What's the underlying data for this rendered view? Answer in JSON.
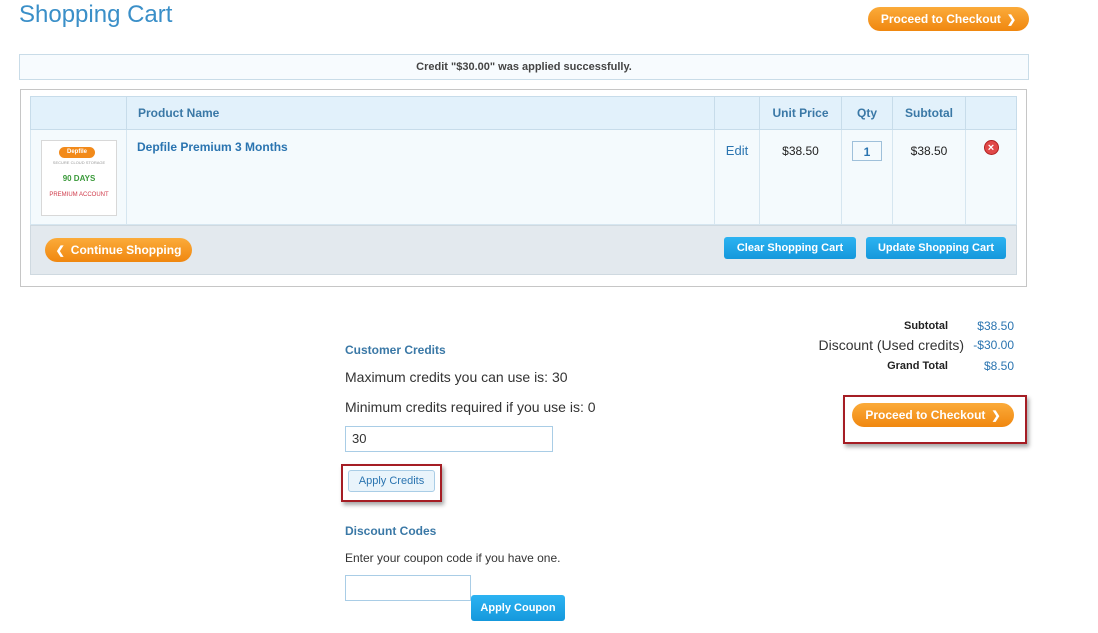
{
  "page": {
    "title": "Shopping Cart"
  },
  "top_checkout": {
    "label": "Proceed to Checkout"
  },
  "message": "Credit \"$30.00\" was applied successfully.",
  "cart": {
    "headers": {
      "product_name": "Product Name",
      "unit_price": "Unit Price",
      "qty": "Qty",
      "subtotal": "Subtotal"
    },
    "items": [
      {
        "thumb": {
          "logo": "Depfile",
          "tagline": "SECURE CLOUD STORAGE",
          "days": "90 DAYS",
          "premium": "PREMIUM ACCOUNT"
        },
        "name": "Depfile Premium 3 Months",
        "edit": "Edit",
        "unit_price": "$38.50",
        "qty": "1",
        "subtotal": "$38.50"
      }
    ],
    "continue_label": "Continue Shopping",
    "clear_label": "Clear Shopping Cart",
    "update_label": "Update Shopping Cart"
  },
  "totals": {
    "subtotal_label": "Subtotal",
    "subtotal_value": "$38.50",
    "discount_label": "Discount (Used credits)",
    "discount_value": "-$30.00",
    "grand_label": "Grand Total",
    "grand_value": "$8.50"
  },
  "checkout_bottom": {
    "label": "Proceed to Checkout"
  },
  "credits": {
    "heading": "Customer Credits",
    "max_text": "Maximum credits you can use is: 30",
    "min_text": "Minimum credits required if you use is: 0",
    "value": "30",
    "apply_label": "Apply Credits"
  },
  "discount": {
    "heading": "Discount Codes",
    "hint": "Enter your coupon code if you have one.",
    "value": "",
    "apply_label": "Apply Coupon"
  },
  "colors": {
    "accent": "#f7941d",
    "link": "#2a74b0",
    "button_blue": "#1ea7ea",
    "highlight_border": "#a51d24"
  },
  "icons": {
    "remove": "remove-icon",
    "chevron_right": "chevron-right-icon",
    "chevron_left": "chevron-left-icon"
  }
}
